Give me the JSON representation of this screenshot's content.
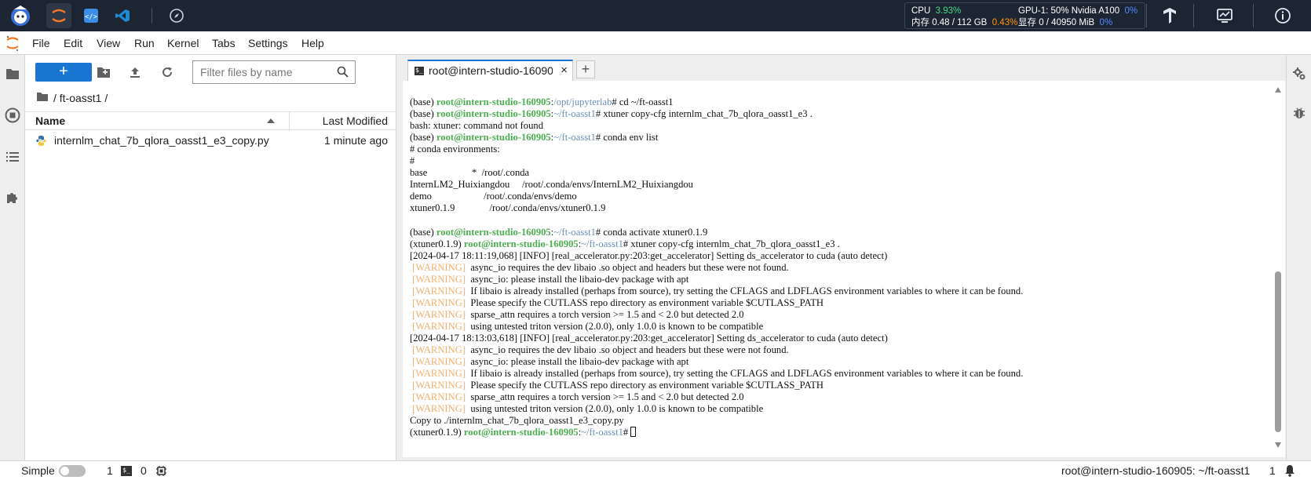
{
  "topbar": {
    "resources": {
      "cpu_label": "CPU",
      "cpu_value": "3.93%",
      "gpu_label": "GPU-1: 50% Nvidia A100",
      "gpu_value": "0%",
      "mem_label": "内存 0.48 / 112 GB",
      "mem_value": "0.43%",
      "vram_label": "显存 0 / 40950 MiB",
      "vram_value": "0%"
    }
  },
  "menu": {
    "items": [
      "File",
      "Edit",
      "View",
      "Run",
      "Kernel",
      "Tabs",
      "Settings",
      "Help"
    ]
  },
  "filebrowser": {
    "new_label": "+",
    "filter_placeholder": "Filter files by name",
    "breadcrumb": "/ ft-oasst1 /",
    "col_name": "Name",
    "col_modified": "Last Modified",
    "files": [
      {
        "name": "internlm_chat_7b_qlora_oasst1_e3_copy.py",
        "modified": "1 minute ago"
      }
    ]
  },
  "terminal": {
    "tab_label": "root@intern-studio-16090",
    "tab_icon": "$_",
    "lines": [
      [
        {
          "t": "(base) "
        },
        {
          "t": "root@intern-studio-160905",
          "c": "pu"
        },
        {
          "t": ":"
        },
        {
          "t": "/opt/jupyterlab",
          "c": "pp"
        },
        {
          "t": "# cd ~/ft-oasst1"
        }
      ],
      [
        {
          "t": "(base) "
        },
        {
          "t": "root@intern-studio-160905",
          "c": "pu"
        },
        {
          "t": ":"
        },
        {
          "t": "~/ft-oasst1",
          "c": "pp"
        },
        {
          "t": "# xtuner copy-cfg internlm_chat_7b_qlora_oasst1_e3 ."
        }
      ],
      [
        {
          "t": "bash: xtuner: command not found"
        }
      ],
      [
        {
          "t": "(base) "
        },
        {
          "t": "root@intern-studio-160905",
          "c": "pu"
        },
        {
          "t": ":"
        },
        {
          "t": "~/ft-oasst1",
          "c": "pp"
        },
        {
          "t": "# conda env list"
        }
      ],
      [
        {
          "t": "# conda environments:"
        }
      ],
      [
        {
          "t": "#"
        }
      ],
      [
        {
          "t": "base                  *  /root/.conda"
        }
      ],
      [
        {
          "t": "InternLM2_Huixiangdou     /root/.conda/envs/InternLM2_Huixiangdou"
        }
      ],
      [
        {
          "t": "demo                     /root/.conda/envs/demo"
        }
      ],
      [
        {
          "t": "xtuner0.1.9              /root/.conda/envs/xtuner0.1.9"
        }
      ],
      [
        {
          "t": ""
        }
      ],
      [
        {
          "t": "(base) "
        },
        {
          "t": "root@intern-studio-160905",
          "c": "pu"
        },
        {
          "t": ":"
        },
        {
          "t": "~/ft-oasst1",
          "c": "pp"
        },
        {
          "t": "# conda activate xtuner0.1.9"
        }
      ],
      [
        {
          "t": "(xtuner0.1.9) "
        },
        {
          "t": "root@intern-studio-160905",
          "c": "pu"
        },
        {
          "t": ":"
        },
        {
          "t": "~/ft-oasst1",
          "c": "pp"
        },
        {
          "t": "# xtuner copy-cfg internlm_chat_7b_qlora_oasst1_e3 ."
        }
      ],
      [
        {
          "t": "[2024-04-17 18:11:19,068] [INFO] [real_accelerator.py:203:get_accelerator] Setting ds_accelerator to cuda (auto detect)"
        }
      ],
      [
        {
          "t": " "
        },
        {
          "t": "[WARNING]",
          "c": "pw"
        },
        {
          "t": "  async_io requires the dev libaio .so object and headers but these were not found."
        }
      ],
      [
        {
          "t": " "
        },
        {
          "t": "[WARNING]",
          "c": "pw"
        },
        {
          "t": "  async_io: please install the libaio-dev package with apt"
        }
      ],
      [
        {
          "t": " "
        },
        {
          "t": "[WARNING]",
          "c": "pw"
        },
        {
          "t": "  If libaio is already installed (perhaps from source), try setting the CFLAGS and LDFLAGS environment variables to where it can be found."
        }
      ],
      [
        {
          "t": " "
        },
        {
          "t": "[WARNING]",
          "c": "pw"
        },
        {
          "t": "  Please specify the CUTLASS repo directory as environment variable $CUTLASS_PATH"
        }
      ],
      [
        {
          "t": " "
        },
        {
          "t": "[WARNING]",
          "c": "pw"
        },
        {
          "t": "  sparse_attn requires a torch version >= 1.5 and < 2.0 but detected 2.0"
        }
      ],
      [
        {
          "t": " "
        },
        {
          "t": "[WARNING]",
          "c": "pw"
        },
        {
          "t": "  using untested triton version (2.0.0), only 1.0.0 is known to be compatible"
        }
      ],
      [
        {
          "t": "[2024-04-17 18:13:03,618] [INFO] [real_accelerator.py:203:get_accelerator] Setting ds_accelerator to cuda (auto detect)"
        }
      ],
      [
        {
          "t": " "
        },
        {
          "t": "[WARNING]",
          "c": "pw"
        },
        {
          "t": "  async_io requires the dev libaio .so object and headers but these were not found."
        }
      ],
      [
        {
          "t": " "
        },
        {
          "t": "[WARNING]",
          "c": "pw"
        },
        {
          "t": "  async_io: please install the libaio-dev package with apt"
        }
      ],
      [
        {
          "t": " "
        },
        {
          "t": "[WARNING]",
          "c": "pw"
        },
        {
          "t": "  If libaio is already installed (perhaps from source), try setting the CFLAGS and LDFLAGS environment variables to where it can be found."
        }
      ],
      [
        {
          "t": " "
        },
        {
          "t": "[WARNING]",
          "c": "pw"
        },
        {
          "t": "  Please specify the CUTLASS repo directory as environment variable $CUTLASS_PATH"
        }
      ],
      [
        {
          "t": " "
        },
        {
          "t": "[WARNING]",
          "c": "pw"
        },
        {
          "t": "  sparse_attn requires a torch version >= 1.5 and < 2.0 but detected 2.0"
        }
      ],
      [
        {
          "t": " "
        },
        {
          "t": "[WARNING]",
          "c": "pw"
        },
        {
          "t": "  using untested triton version (2.0.0), only 1.0.0 is known to be compatible"
        }
      ],
      [
        {
          "t": "Copy to ./internlm_chat_7b_qlora_oasst1_e3_copy.py"
        }
      ],
      [
        {
          "t": "(xtuner0.1.9) "
        },
        {
          "t": "root@intern-studio-160905",
          "c": "pu"
        },
        {
          "t": ":"
        },
        {
          "t": "~/ft-oasst1",
          "c": "pp"
        },
        {
          "t": "# "
        },
        {
          "cursor": true
        }
      ]
    ]
  },
  "statusbar": {
    "mode_label": "Simple",
    "kernels_count": "1",
    "terminals_count": "0",
    "path": "root@intern-studio-160905: ~/ft-oasst1",
    "tab_index": "1"
  }
}
